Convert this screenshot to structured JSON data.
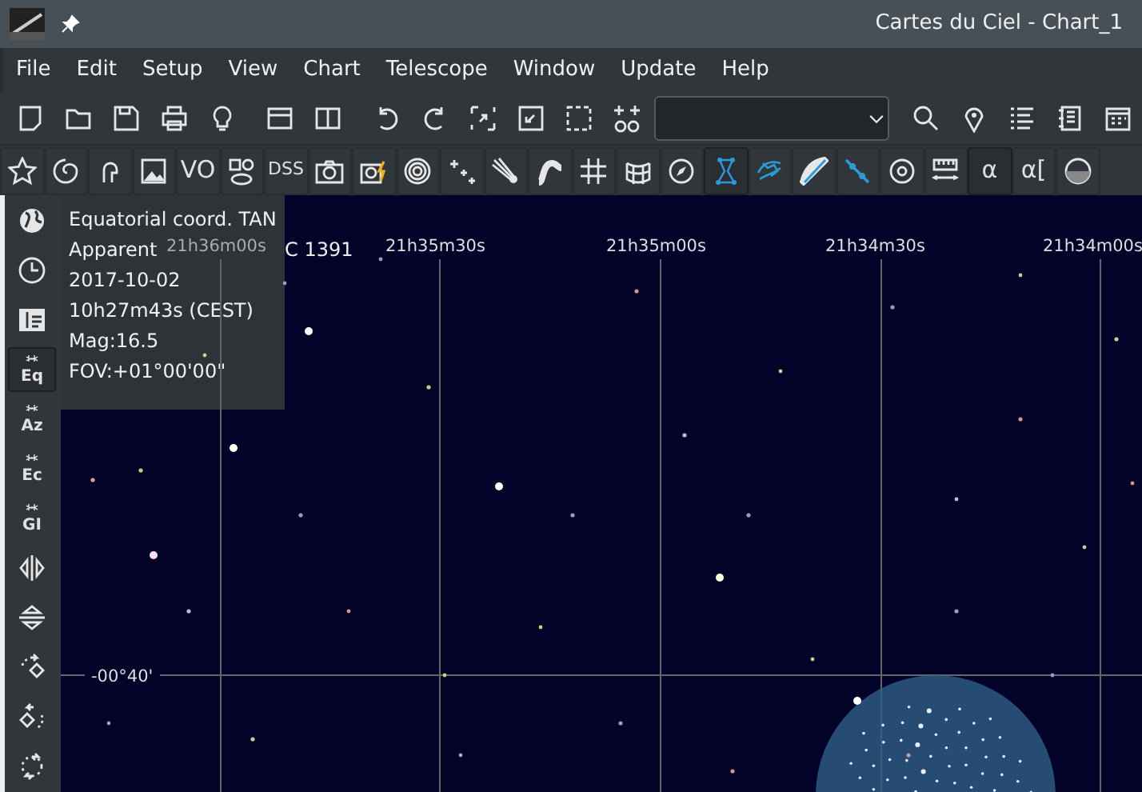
{
  "window": {
    "title": "Cartes du Ciel - Chart_1"
  },
  "menu": [
    "File",
    "Edit",
    "Setup",
    "View",
    "Chart",
    "Telescope",
    "Window",
    "Update",
    "Help"
  ],
  "toolbar_2": [
    {
      "kind": "icon",
      "pressed": false
    },
    {
      "kind": "icon",
      "pressed": false
    },
    {
      "kind": "icon",
      "pressed": false
    },
    {
      "kind": "icon",
      "pressed": false
    },
    {
      "kind": "text",
      "label": "VO",
      "pressed": false
    },
    {
      "kind": "icon",
      "pressed": false
    },
    {
      "kind": "text",
      "label": "DSS",
      "pressed": false
    },
    {
      "kind": "icon",
      "pressed": false
    },
    {
      "kind": "icon",
      "pressed": false
    },
    {
      "kind": "icon",
      "pressed": false
    },
    {
      "kind": "icon",
      "pressed": false
    },
    {
      "kind": "icon",
      "pressed": false
    },
    {
      "kind": "icon",
      "pressed": false
    },
    {
      "kind": "icon",
      "pressed": false
    },
    {
      "kind": "icon",
      "pressed": false
    },
    {
      "kind": "icon",
      "pressed": false
    },
    {
      "kind": "icon",
      "pressed": true
    },
    {
      "kind": "icon",
      "pressed": false
    },
    {
      "kind": "icon",
      "pressed": false
    },
    {
      "kind": "icon",
      "pressed": false
    },
    {
      "kind": "icon",
      "pressed": false
    },
    {
      "kind": "icon",
      "pressed": false
    },
    {
      "kind": "text",
      "label": "α",
      "pressed": true
    },
    {
      "kind": "text",
      "label": "α[",
      "pressed": false
    },
    {
      "kind": "icon",
      "pressed": false
    }
  ],
  "sidebar": [
    {
      "kind": "icon",
      "pressed": false
    },
    {
      "kind": "icon",
      "pressed": false
    },
    {
      "kind": "icon",
      "pressed": false
    },
    {
      "kind": "grid",
      "label": "Eq",
      "pressed": true
    },
    {
      "kind": "grid",
      "label": "Az",
      "pressed": false
    },
    {
      "kind": "grid",
      "label": "Ec",
      "pressed": false
    },
    {
      "kind": "grid",
      "label": "GI",
      "pressed": false
    },
    {
      "kind": "icon",
      "pressed": false
    },
    {
      "kind": "icon",
      "pressed": false
    },
    {
      "kind": "icon",
      "pressed": false
    },
    {
      "kind": "icon",
      "pressed": false
    },
    {
      "kind": "icon",
      "pressed": false
    }
  ],
  "chart": {
    "ra_labels": [
      "21h36m00s",
      "21h35m30s",
      "21h35m00s",
      "21h34m30s",
      "21h34m00s"
    ],
    "dec_labels": [
      "-00°40'"
    ],
    "object_label": "C 1391"
  },
  "info_panel": [
    "Equatorial coord. TAN",
    "Apparent",
    "2017-10-02",
    "10h27m43s (CEST)",
    "Mag:16.5",
    "FOV:+01°00'00\""
  ]
}
